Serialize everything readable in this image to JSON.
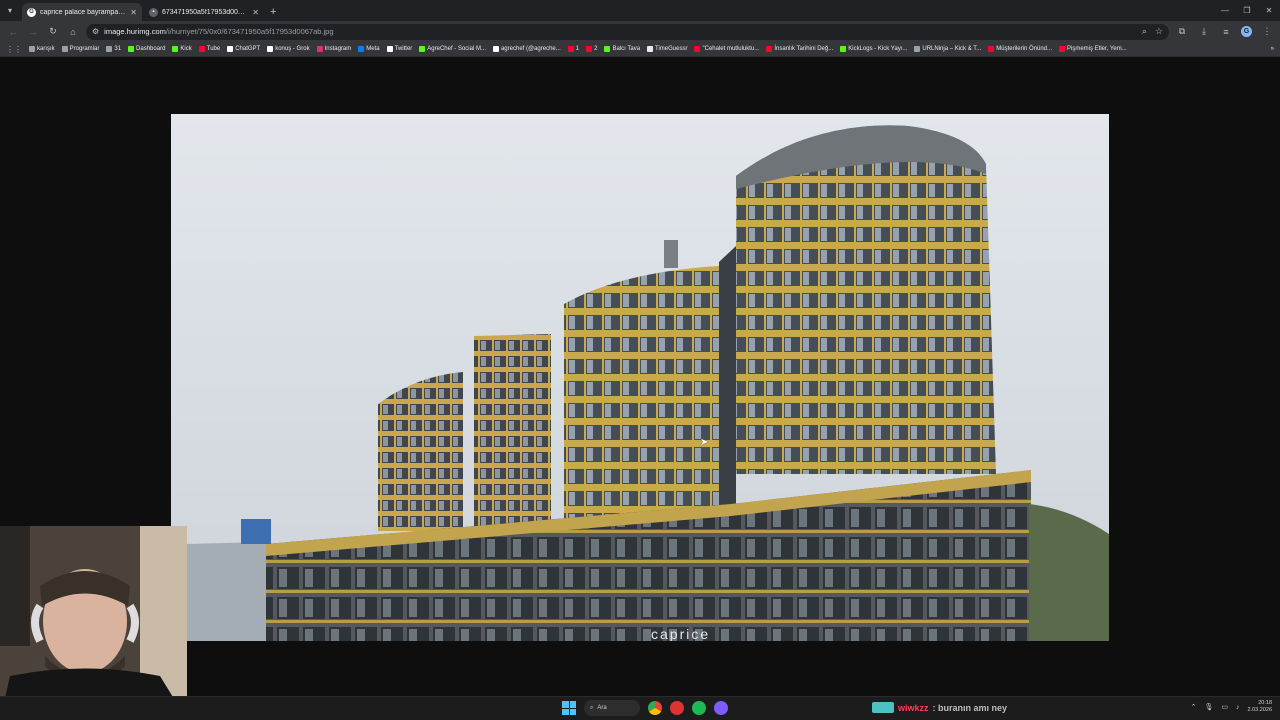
{
  "browser": {
    "tabs": [
      {
        "title": "caprice palace bayrampaşa - G",
        "active": true
      },
      {
        "title": "673471950a5f17953d0067ab.jpg",
        "active": false
      }
    ],
    "url_host": "image.hurimg.com",
    "url_path": "/i/hurriyet/75/0x0/673471950a5f17953d0067ab.jpg",
    "profile_initial": "G"
  },
  "bookmarks": [
    {
      "label": "karışık",
      "color": "#9aa0a6"
    },
    {
      "label": "Programlar",
      "color": "#9aa0a6"
    },
    {
      "label": "31",
      "color": "#9aa0a6"
    },
    {
      "label": "Dashboard",
      "color": "#53fc18"
    },
    {
      "label": "Kick",
      "color": "#53fc18"
    },
    {
      "label": "Tube",
      "color": "#ff0033"
    },
    {
      "label": "ChatGPT",
      "color": "#ffffff"
    },
    {
      "label": "konuş - Grok",
      "color": "#ffffff"
    },
    {
      "label": "Instagram",
      "color": "#e1306c"
    },
    {
      "label": "Meta",
      "color": "#0081fb"
    },
    {
      "label": "Twitter",
      "color": "#ffffff"
    },
    {
      "label": "AgreChef - Social M...",
      "color": "#53fc18"
    },
    {
      "label": "agrechef (@agreche...",
      "color": "#ffffff"
    },
    {
      "label": "1",
      "color": "#ff0033"
    },
    {
      "label": "2",
      "color": "#ff0033"
    },
    {
      "label": "Balcı Tava",
      "color": "#53fc18"
    },
    {
      "label": "TimeGuessr",
      "color": "#e8eaed"
    },
    {
      "label": "\"Cehalet mutluluktu...",
      "color": "#ff0033"
    },
    {
      "label": "İnsanlık Tarihini Değ...",
      "color": "#ff0033"
    },
    {
      "label": "KickLogs - Kick Yayı...",
      "color": "#53fc18"
    },
    {
      "label": "URLNinja – Kick & T...",
      "color": "#9aa0a6"
    },
    {
      "label": "Müşterilerin Önünd...",
      "color": "#ff0033"
    },
    {
      "label": "Pişmemiş Etler, Yem...",
      "color": "#ff0033"
    }
  ],
  "taskbar": {
    "search_label": "Ara",
    "chat_user": "wiwkzz",
    "chat_message": ": buranın amı ney",
    "time": "20:18",
    "date": "2.03.2026"
  },
  "photo": {
    "sign_text": "caprice"
  }
}
